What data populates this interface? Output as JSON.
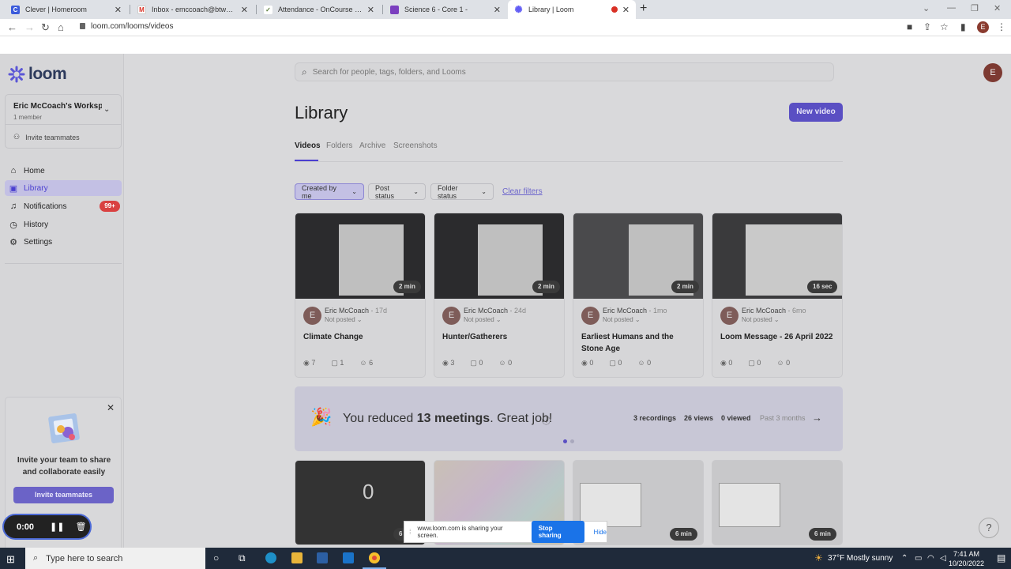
{
  "browser": {
    "tabs": [
      {
        "title": "Clever | Homeroom",
        "icon": "clever-icon",
        "color": "#3b5bdb"
      },
      {
        "title": "Inbox - emccoach@btwpschools",
        "icon": "gmail-icon",
        "color": "#d93025"
      },
      {
        "title": "Attendance - OnCourse Systems",
        "icon": "oncourse-icon",
        "color": "#5a7d3a"
      },
      {
        "title": "Science 6 - Core 1 -",
        "icon": "classroom-icon",
        "color": "#7b3fbf"
      },
      {
        "title": "Library | Loom",
        "icon": "loom-icon",
        "color": "#625df5"
      }
    ],
    "url": "loom.com/looms/videos",
    "profile_initial": "E"
  },
  "sidebar": {
    "logo": "loom",
    "workspace_name": "Eric McCoach's Worksp...",
    "workspace_members": "1 member",
    "invite_label": "Invite teammates",
    "nav": [
      {
        "label": "Home",
        "icon": "home-icon"
      },
      {
        "label": "Library",
        "icon": "library-icon"
      },
      {
        "label": "Notifications",
        "icon": "bell-icon"
      },
      {
        "label": "History",
        "icon": "clock-icon"
      },
      {
        "label": "Settings",
        "icon": "gear-icon"
      }
    ],
    "notifications_badge": "99+",
    "promo": {
      "text": "Invite your team to share and collaborate easily",
      "button": "Invite teammates"
    }
  },
  "recorder": {
    "time": "0:00"
  },
  "main": {
    "search_placeholder": "Search for people, tags, folders, and Looms",
    "avatar_initial": "E",
    "title": "Library",
    "new_video": "New video",
    "tabs": [
      "Videos",
      "Folders",
      "Archive",
      "Screenshots"
    ],
    "filters": [
      "Created by me",
      "Post status",
      "Folder status"
    ],
    "clear_filters": "Clear filters",
    "videos": [
      {
        "duration": "2 min",
        "author": "Eric McCoach",
        "age": "17d",
        "status": "Not posted",
        "title": "Climate Change",
        "views": "7",
        "comments": "1",
        "reactions": "6"
      },
      {
        "duration": "2 min",
        "author": "Eric McCoach",
        "age": "24d",
        "status": "Not posted",
        "title": "Hunter/Gatherers",
        "views": "3",
        "comments": "0",
        "reactions": "0"
      },
      {
        "duration": "2 min",
        "author": "Eric McCoach",
        "age": "1mo",
        "status": "Not posted",
        "title": "Earliest Humans and the Stone Age",
        "views": "0",
        "comments": "0",
        "reactions": "0"
      },
      {
        "duration": "16 sec",
        "author": "Eric McCoach",
        "age": "6mo",
        "status": "Not posted",
        "title": "Loom Message - 26 April 2022",
        "views": "0",
        "comments": "0",
        "reactions": "0"
      }
    ],
    "banner": {
      "prefix": "You reduced ",
      "highlight": "13 meetings",
      "suffix": ". Great job!",
      "recordings": "3 recordings",
      "views": "26 views",
      "viewed": "0 viewed",
      "period": "Past 3 months"
    },
    "second_row_durations": [
      "6",
      "",
      "6 min",
      "6 min"
    ]
  },
  "share_bar": {
    "text": "www.loom.com is sharing your screen.",
    "stop": "Stop sharing",
    "hide": "Hide"
  },
  "taskbar": {
    "search_placeholder": "Type here to search",
    "weather": "37°F  Mostly sunny",
    "time": "7:41 AM",
    "date": "10/20/2022"
  }
}
